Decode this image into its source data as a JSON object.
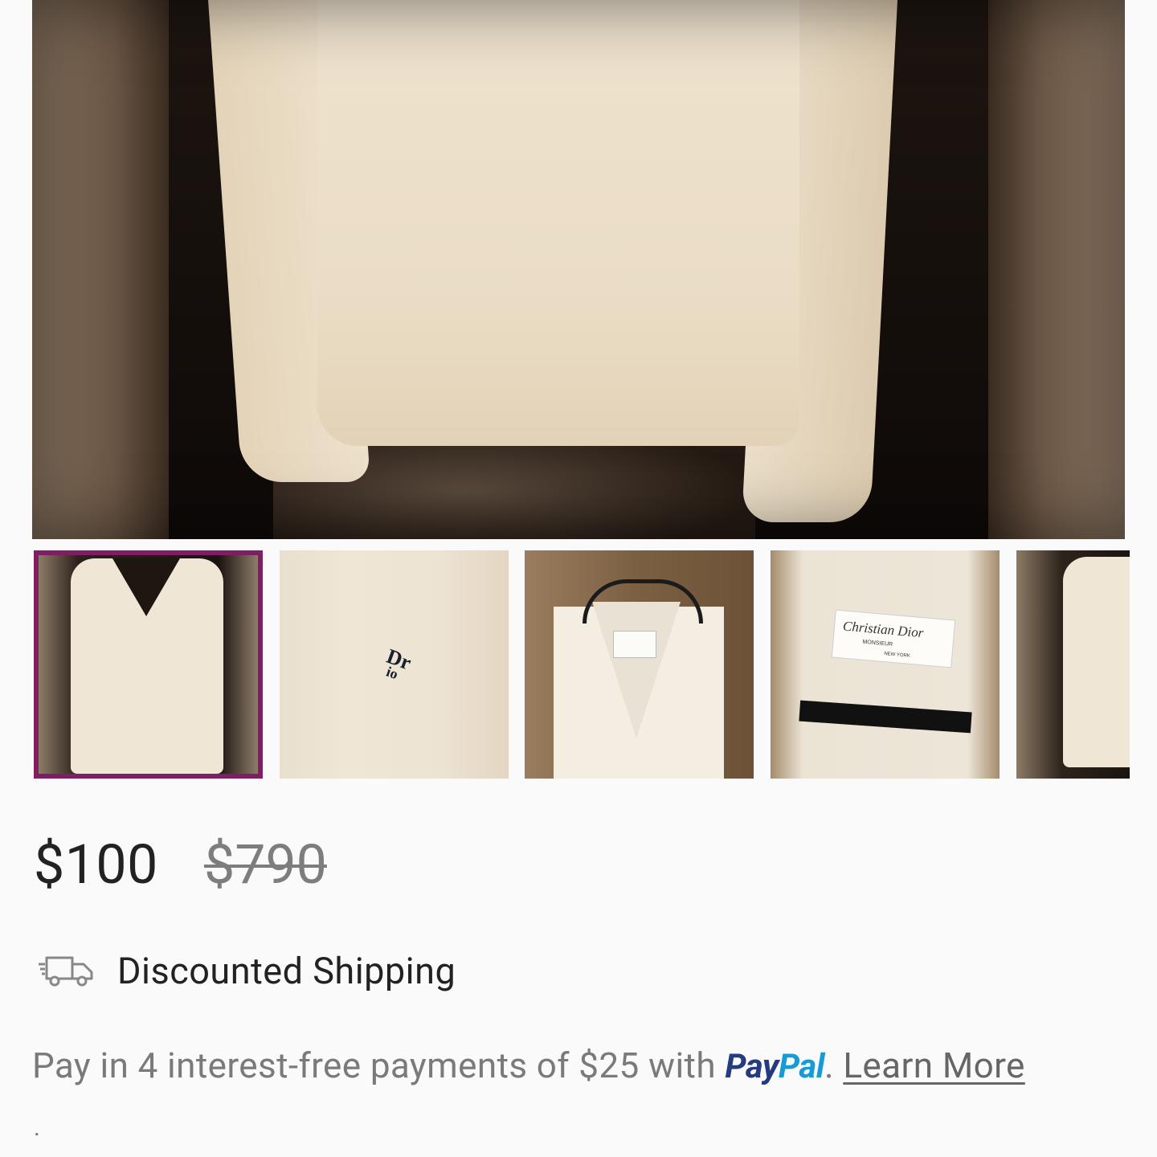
{
  "product": {
    "price": "$100",
    "original_price": "$790"
  },
  "gallery": {
    "selected_index": 0,
    "thumbnail_count": 5,
    "selected_border_color": "#7e1e64"
  },
  "shipping": {
    "icon": "truck-icon",
    "label": "Discounted Shipping"
  },
  "payment": {
    "prefix": "Pay in 4 interest-free payments of $25 with ",
    "paypal_pay": "Pay",
    "paypal_pal": "Pal",
    "suffix": ". ",
    "learn_more": "Learn More",
    "trailing": "."
  }
}
